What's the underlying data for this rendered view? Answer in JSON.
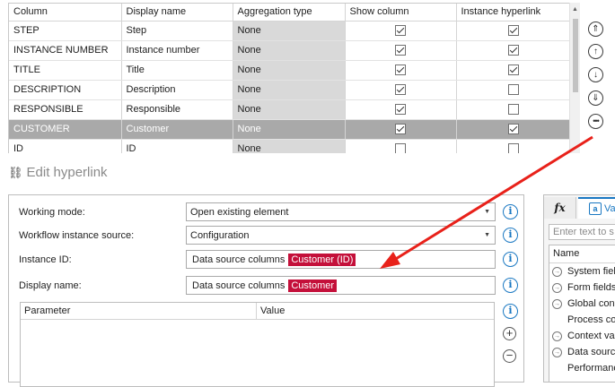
{
  "grid": {
    "headers": [
      "Column",
      "Display name",
      "Aggregation type",
      "Show column",
      "Instance hyperlink"
    ],
    "rows": [
      {
        "column": "STEP",
        "display": "Step",
        "agg": "None",
        "show": true,
        "link": true
      },
      {
        "column": "INSTANCE NUMBER",
        "display": "Instance number",
        "agg": "None",
        "show": true,
        "link": true
      },
      {
        "column": "TITLE",
        "display": "Title",
        "agg": "None",
        "show": true,
        "link": true
      },
      {
        "column": "DESCRIPTION",
        "display": "Description",
        "agg": "None",
        "show": true,
        "link": false
      },
      {
        "column": "RESPONSIBLE",
        "display": "Responsible",
        "agg": "None",
        "show": true,
        "link": false
      },
      {
        "column": "CUSTOMER",
        "display": "Customer",
        "agg": "None",
        "show": true,
        "link": true,
        "selected": true
      },
      {
        "column": "ID",
        "display": "ID",
        "agg": "None",
        "show": false,
        "link": false
      }
    ]
  },
  "edit": {
    "title": "Edit hyperlink",
    "working_mode_label": "Working mode:",
    "working_mode_value": "Open existing element",
    "source_label": "Workflow instance source:",
    "source_value": "Configuration",
    "instance_id_label": "Instance ID:",
    "instance_id_plain": "Data source columns",
    "instance_id_token": "Customer (ID)",
    "display_name_label": "Display name:",
    "display_name_plain": "Data source columns",
    "display_name_token": "Customer",
    "param_headers": [
      "Parameter",
      "Value"
    ]
  },
  "side": {
    "tab_fx": "fx",
    "tab_values": "Va",
    "search_placeholder": "Enter text to s",
    "list_header": "Name",
    "items": [
      {
        "label": "System fiel",
        "arrow": true
      },
      {
        "label": "Form fields",
        "arrow": true
      },
      {
        "label": "Global cons",
        "arrow": true
      },
      {
        "label": "Process co",
        "arrow": false
      },
      {
        "label": "Context va",
        "arrow": true
      },
      {
        "label": "Data sourc",
        "arrow": true
      },
      {
        "label": "Performanc",
        "arrow": false
      }
    ]
  },
  "colors": {
    "token_red": "#c4103a",
    "info_blue": "#1a78c2",
    "selected_row": "#a9a9a9",
    "arrow_red": "#e8211a"
  }
}
